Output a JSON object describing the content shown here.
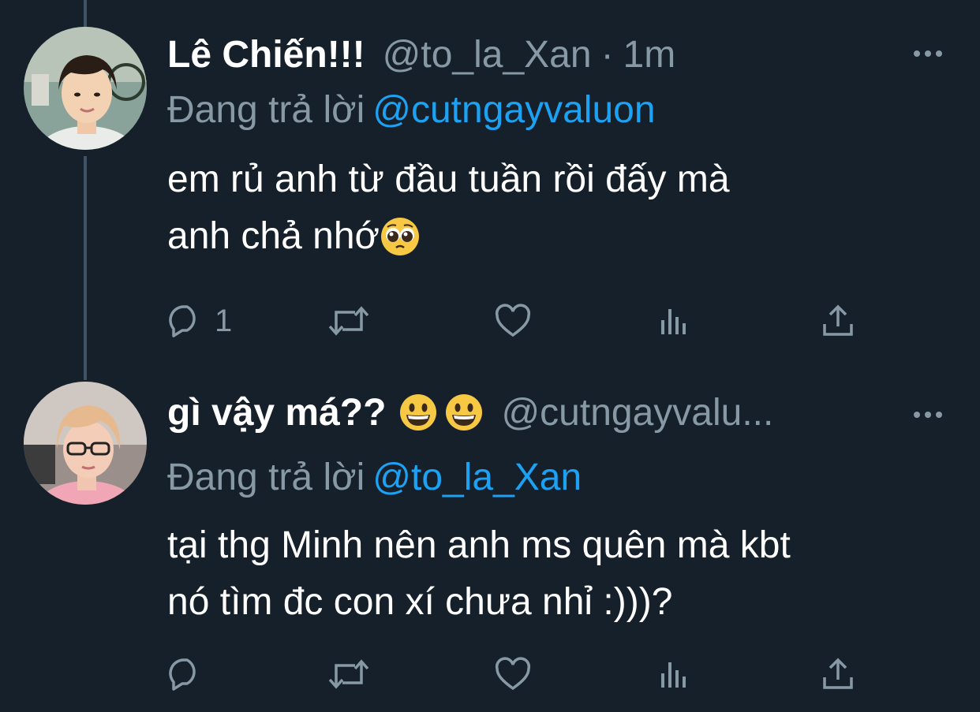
{
  "tweets": [
    {
      "name": "Lê Chiến!!!",
      "handle": "@to_la_Xan",
      "separator": "·",
      "time": "1m",
      "replying_prefix": "Đang trả lời",
      "replying_to": "@cutngayvaluon",
      "text_line1": "em rủ anh từ đầu tuần rồi đấy mà",
      "text_line2": "anh chả nhớ",
      "reply_count": "1",
      "icons": {
        "reply": "reply-icon",
        "retweet": "retweet-icon",
        "like": "like-icon",
        "analytics": "analytics-icon",
        "share": "share-icon",
        "more": "more-icon",
        "emoji": "pleading-face-icon"
      }
    },
    {
      "name": "gì vậy má??",
      "handle": "@cutngayvalu...",
      "replying_prefix": "Đang trả lời",
      "replying_to": "@to_la_Xan",
      "text_line1": "tại thg Minh nên anh ms quên mà kbt",
      "text_line2": "nó tìm đc con xí chưa nhỉ :)))?",
      "reply_count": "",
      "icons": {
        "reply": "reply-icon",
        "retweet": "retweet-icon",
        "like": "like-icon",
        "analytics": "analytics-icon",
        "share": "share-icon",
        "more": "more-icon",
        "emoji": "grinning-face-icon"
      }
    }
  ],
  "colors": {
    "background": "#15202b",
    "text": "#ffffff",
    "secondary": "#8899a6",
    "accent": "#1da1f2",
    "thread_line": "#3d5466"
  }
}
